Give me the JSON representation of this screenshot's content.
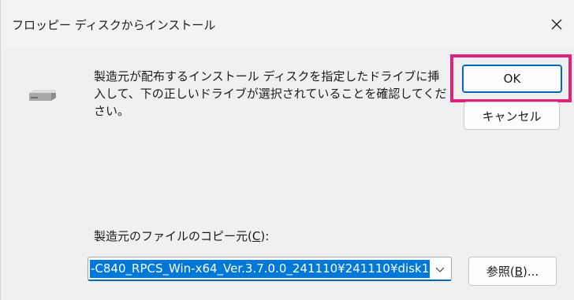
{
  "window": {
    "title": "フロッピー ディスクからインストール"
  },
  "message": {
    "text": "製造元が配布するインストール ディスクを指定したドライブに挿入して、下の正しいドライブが選択されていることを確認してください。"
  },
  "buttons": {
    "ok_label": "OK",
    "cancel_label": "キャンセル",
    "browse_prefix": "参照(",
    "browse_key": "B",
    "browse_suffix": ")..."
  },
  "source": {
    "label_prefix": "製造元のファイルのコピー元(",
    "label_key": "C",
    "label_suffix": "):",
    "path_value": "-C840_RPCS_Win-x64_Ver.3.7.0.0_241110¥241110¥disk1"
  },
  "icons": {
    "disk": "floppy-drive-icon",
    "close": "close-icon",
    "dropdown": "chevron-down-icon"
  },
  "colors": {
    "accent": "#0067c0",
    "selection": "#0078d7",
    "highlight": "#e0237a"
  }
}
